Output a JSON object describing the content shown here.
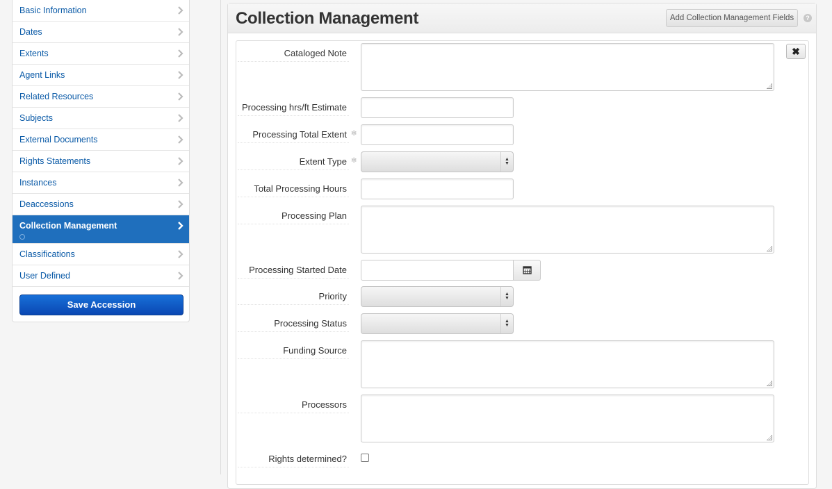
{
  "sidebar": {
    "items": [
      {
        "label": "Basic Information"
      },
      {
        "label": "Dates"
      },
      {
        "label": "Extents"
      },
      {
        "label": "Agent Links"
      },
      {
        "label": "Related Resources"
      },
      {
        "label": "Subjects"
      },
      {
        "label": "External Documents"
      },
      {
        "label": "Rights Statements"
      },
      {
        "label": "Instances"
      },
      {
        "label": "Deaccessions"
      },
      {
        "label": "Collection Management",
        "active": true
      },
      {
        "label": "Classifications"
      },
      {
        "label": "User Defined"
      }
    ],
    "save_label": "Save Accession"
  },
  "main": {
    "title": "Collection Management",
    "add_fields_label": "Add Collection Management Fields",
    "help_icon": "?",
    "remove_icon": "✖",
    "colors": {
      "active_nav": "#1f6fbd",
      "save_button": "#0a47b3",
      "link": "#0a5aa7"
    },
    "fields": {
      "cataloged_note": {
        "label": "Cataloged Note",
        "value": ""
      },
      "processing_hrs_estimate": {
        "label": "Processing hrs/ft Estimate",
        "value": ""
      },
      "processing_total_extent": {
        "label": "Processing Total Extent",
        "value": ""
      },
      "extent_type": {
        "label": "Extent Type",
        "value": ""
      },
      "total_processing_hours": {
        "label": "Total Processing Hours",
        "value": ""
      },
      "processing_plan": {
        "label": "Processing Plan",
        "value": ""
      },
      "processing_started_date": {
        "label": "Processing Started Date",
        "value": ""
      },
      "priority": {
        "label": "Priority",
        "value": ""
      },
      "processing_status": {
        "label": "Processing Status",
        "value": ""
      },
      "funding_source": {
        "label": "Funding Source",
        "value": ""
      },
      "processors": {
        "label": "Processors",
        "value": ""
      },
      "rights_determined": {
        "label": "Rights determined?",
        "checked": false
      }
    }
  }
}
